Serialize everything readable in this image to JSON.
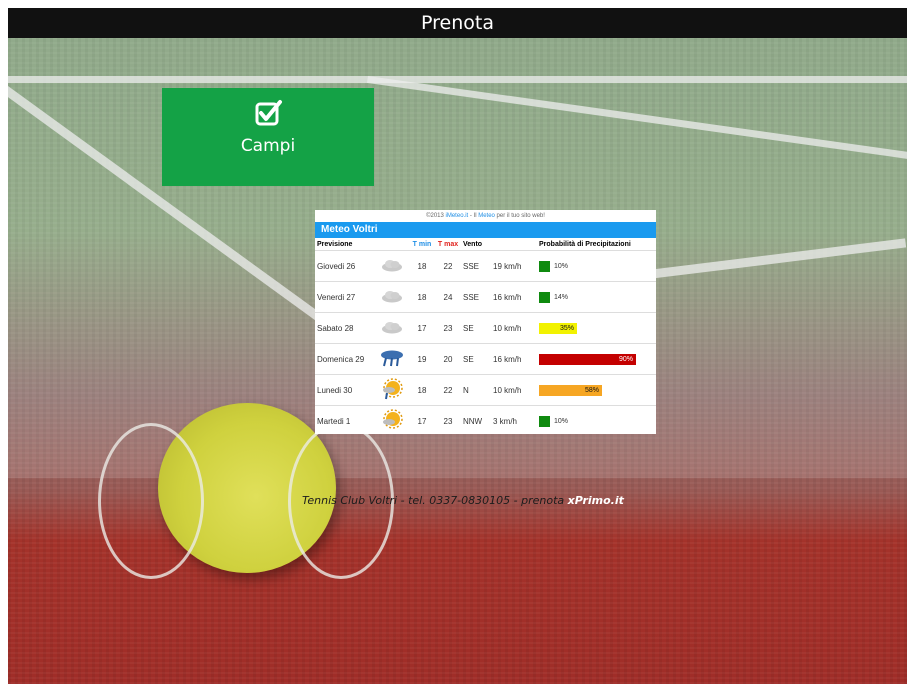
{
  "header": {
    "title": "Prenota"
  },
  "campi": {
    "label": "Campi",
    "icon": "checkbox-check-icon",
    "color": "#14a246"
  },
  "meteo": {
    "copyright_prefix": "©2013 ",
    "copyright_link": "iMeteo.it",
    "copyright_mid": " - Il ",
    "copyright_link2": "Meteo",
    "copyright_suffix": " per il tuo sito web!",
    "title": "Meteo Voltri",
    "headers": {
      "previsione": "Previsione",
      "tmin": "T min",
      "tmax": "T max",
      "vento": "Vento",
      "prob": "Probabilità di Precipitazioni"
    },
    "rows": [
      {
        "day": "Giovedi 26",
        "icon": "cloud",
        "tmin": "18",
        "tmax": "22",
        "dir": "SSE",
        "speed": "19 km/h",
        "prob": 10,
        "prob_label": "10%",
        "color": "#0f8a0f"
      },
      {
        "day": "Venerdi 27",
        "icon": "cloud",
        "tmin": "18",
        "tmax": "24",
        "dir": "SSE",
        "speed": "16 km/h",
        "prob": 14,
        "prob_label": "14%",
        "color": "#0f8a0f"
      },
      {
        "day": "Sabato 28",
        "icon": "cloud",
        "tmin": "17",
        "tmax": "23",
        "dir": "SE",
        "speed": "10 km/h",
        "prob": 35,
        "prob_label": "35%",
        "color": "#f2f200"
      },
      {
        "day": "Domenica 29",
        "icon": "rain",
        "tmin": "19",
        "tmax": "20",
        "dir": "SE",
        "speed": "16 km/h",
        "prob": 90,
        "prob_label": "90%",
        "color": "#c40000"
      },
      {
        "day": "Lunedi 30",
        "icon": "sun-rain",
        "tmin": "18",
        "tmax": "22",
        "dir": "N",
        "speed": "10 km/h",
        "prob": 58,
        "prob_label": "58%",
        "color": "#f6a623"
      },
      {
        "day": "Martedi 1",
        "icon": "sun-cloud",
        "tmin": "17",
        "tmax": "23",
        "dir": "NNW",
        "speed": "3 km/h",
        "prob": 10,
        "prob_label": "10%",
        "color": "#0f8a0f"
      }
    ]
  },
  "footer": {
    "text": "Tennis Club Voltri - tel. 0337-0830105 - prenota ",
    "brand": "xPrimo.it"
  }
}
